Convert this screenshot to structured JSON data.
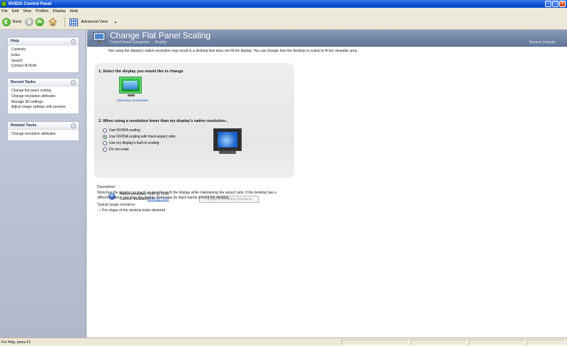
{
  "window": {
    "title": "NVIDIA Control Panel"
  },
  "menu": [
    "File",
    "Edit",
    "View",
    "Profiles",
    "Display",
    "Help"
  ],
  "toolbar": {
    "back_label": "Back",
    "view_label": "Advanced View"
  },
  "sidebar": {
    "help": {
      "title": "Help",
      "items": [
        "Contents",
        "Index",
        "Search",
        "Contact NVIDIA"
      ]
    },
    "recent": {
      "title": "Recent Tasks",
      "items": [
        "Change flat panel scaling",
        "Change resolution attributes",
        "Manage 3D settings",
        "Adjust image settings with preview"
      ]
    },
    "related": {
      "title": "Related Tasks",
      "items": [
        "Change resolution attributes"
      ]
    }
  },
  "page": {
    "title": "Change Flat Panel Scaling",
    "breadcrumb": "Control Panel Categories  →  Display",
    "restore": "Restore Defaults",
    "intro": "Not using the display's native resolution may result in a desktop that does not fill the display. You can change how the desktop is scaled to fit the viewable area.",
    "step1": "1. Select the display you would like to change",
    "display_name": "Samsung SyncMaster",
    "step2": "2. When using a resolution lower than my display's native resolution...",
    "options": [
      {
        "label": "Use NVIDIA scaling",
        "selected": false
      },
      {
        "label": "Use NVIDIA scaling with fixed-aspect ratio",
        "selected": true
      },
      {
        "label": "Use my display's built-in scaling",
        "selected": false
      },
      {
        "label": "Do not scale",
        "selected": false
      }
    ],
    "native_label": "Native resolution:",
    "native_value": "1680 by 1050",
    "current_label": "Current resolution:",
    "current_value": "1680 by 1050",
    "native_button": "Change to the Native Resolution",
    "description_title": "Description:",
    "description_line1": "Stretches the desktop as much as possible to fit the display while maintaining the aspect ratio. If the desktop has a",
    "description_line2": "different aspect ratio than the display, there may be black bands around the desktop.",
    "usage_title": "Typical usage scenarios:",
    "usage_item": "The shape of the desktop looks distorted"
  },
  "status": {
    "text": "For Help, press F1"
  },
  "colors": {
    "titlebar": "#0b4fd4",
    "banner": "#6f82a3",
    "accent_green": "#76b900",
    "link": "#1e4fb8"
  }
}
